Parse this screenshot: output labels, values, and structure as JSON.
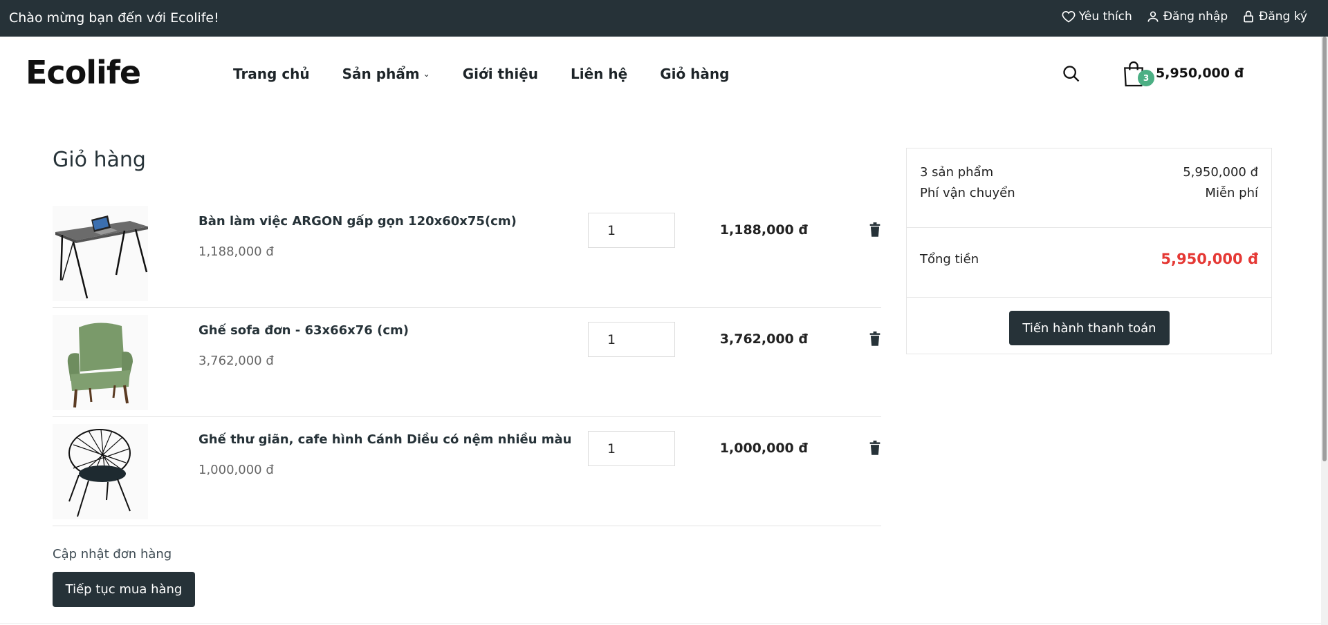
{
  "topbar": {
    "welcome": "Chào mừng bạn đến với Ecolife!",
    "wishlist": "Yêu thích",
    "login": "Đăng nhập",
    "register": "Đăng ký"
  },
  "header": {
    "logo": "Ecolife",
    "nav": [
      "Trang chủ",
      "Sản phẩm",
      "Giới thiệu",
      "Liên hệ",
      "Giỏ hàng"
    ],
    "cart_count": "3",
    "cart_total": "5,950,000 đ"
  },
  "cart": {
    "title": "Giỏ hàng",
    "items": [
      {
        "name": "Bàn làm việc ARGON gấp gọn 120x60x75(cm)",
        "price": "1,188,000 đ",
        "qty": "1",
        "total": "1,188,000 đ",
        "image": "desk-image"
      },
      {
        "name": "Ghế sofa đơn - 63x66x76 (cm)",
        "price": "3,762,000 đ",
        "qty": "1",
        "total": "3,762,000 đ",
        "image": "green-armchair-image"
      },
      {
        "name": "Ghế thư giãn, cafe hình Cánh Diều có nệm nhiều màu",
        "price": "1,000,000 đ",
        "qty": "1",
        "total": "1,000,000 đ",
        "image": "wire-chair-image"
      }
    ],
    "update_label": "Cập nhật đơn hàng",
    "continue_label": "Tiếp tục mua hàng"
  },
  "summary": {
    "items_label": "3 sản phẩm",
    "items_value": "5,950,000 đ",
    "shipping_label": "Phí vận chuyển",
    "shipping_value": "Miễn phí",
    "total_label": "Tổng tiền",
    "total_value": "5,950,000 đ",
    "checkout_label": "Tiến hành thanh toán"
  },
  "colors": {
    "dark": "#263238",
    "accent_green": "#4caf84",
    "price_red": "#e53935"
  }
}
